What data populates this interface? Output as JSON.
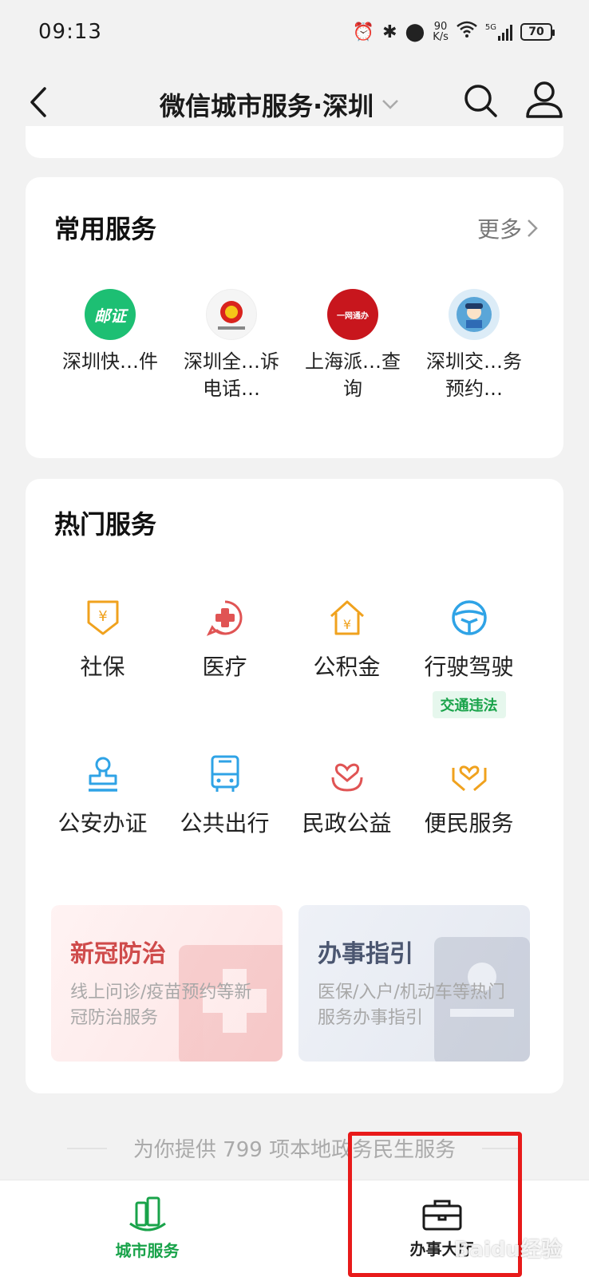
{
  "status_bar": {
    "time": "09:13",
    "net_speed_value": "90",
    "net_speed_unit": "K/s",
    "network": "5G",
    "battery": "70"
  },
  "nav": {
    "title": "微信城市服务·深圳"
  },
  "common_services": {
    "title": "常用服务",
    "more_label": "更多",
    "items": [
      {
        "label": "深圳快…件",
        "logo_text": "邮证",
        "logo_color": "#1dbf73"
      },
      {
        "label": "深圳全…诉电话…",
        "logo_text": "",
        "logo_color": "#f5f5f5"
      },
      {
        "label": "上海派…查询",
        "logo_text": "一网通办",
        "logo_color": "#c8161d"
      },
      {
        "label": "深圳交…务预约…",
        "logo_text": "",
        "logo_color": "#dcecf7"
      }
    ]
  },
  "hot_services": {
    "title": "热门服务",
    "items": [
      {
        "label": "社保",
        "icon": "social-insurance-icon",
        "color": "#f0a21e"
      },
      {
        "label": "医疗",
        "icon": "medical-icon",
        "color": "#e05454"
      },
      {
        "label": "公积金",
        "icon": "housing-fund-icon",
        "color": "#f0a21e"
      },
      {
        "label": "行驶驾驶",
        "icon": "steering-wheel-icon",
        "color": "#2fa3e6",
        "tag": "交通违法"
      },
      {
        "label": "公安办证",
        "icon": "police-certificate-icon",
        "color": "#2fa3e6"
      },
      {
        "label": "公共出行",
        "icon": "bus-icon",
        "color": "#2fa3e6"
      },
      {
        "label": "民政公益",
        "icon": "civil-affairs-icon",
        "color": "#e05454"
      },
      {
        "label": "便民服务",
        "icon": "convenience-icon",
        "color": "#f0a21e"
      }
    ],
    "promos": [
      {
        "title": "新冠防治",
        "desc": "线上问诊/疫苗预约等新冠防治服务"
      },
      {
        "title": "办事指引",
        "desc": "医保/入户/机动车等热门服务办事指引"
      }
    ]
  },
  "footer_notice": "为你提供 799 项本地政务民生服务",
  "tab_bar": {
    "tabs": [
      {
        "label": "城市服务",
        "active": true
      },
      {
        "label": "办事大厅",
        "active": false
      }
    ]
  },
  "colors": {
    "accent_green": "#19a34a",
    "highlight_red": "#e81a1a"
  },
  "watermark": "Baidu经验"
}
